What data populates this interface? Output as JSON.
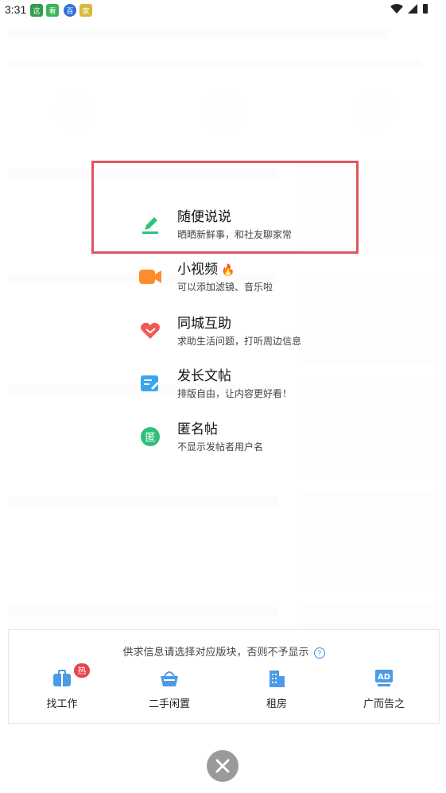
{
  "status_bar": {
    "time": "3:31",
    "apps": [
      "这",
      "看",
      "百",
      "家"
    ]
  },
  "menu": {
    "items": [
      {
        "title": "随便说说",
        "subtitle": "晒晒新鲜事，和社友聊家常",
        "icon": "pencil-icon"
      },
      {
        "title": "小视频",
        "subtitle": "可以添加滤镜、音乐啦",
        "icon": "video-icon",
        "badge": "fire-icon"
      },
      {
        "title": "同城互助",
        "subtitle": "求助生活问题，打听周边信息",
        "icon": "heart-hands-icon"
      },
      {
        "title": "发长文帖",
        "subtitle": "排版自由，让内容更好看！",
        "icon": "document-edit-icon"
      },
      {
        "title": "匿名帖",
        "subtitle": "不显示发帖者用户名",
        "icon": "anonymous-icon"
      }
    ]
  },
  "panel": {
    "note": "供求信息请选择对应版块，否则不予显示",
    "hot_badge": "热",
    "categories": [
      {
        "label": "找工作",
        "icon": "briefcase-icon"
      },
      {
        "label": "二手闲置",
        "icon": "basket-icon"
      },
      {
        "label": "租房",
        "icon": "building-icon"
      },
      {
        "label": "广而告之",
        "icon": "ad-board-icon"
      }
    ]
  },
  "colors": {
    "pencil": "#2fc27a",
    "video": "#fb8d2a",
    "help": "#f05a52",
    "doc": "#3ba4f0",
    "anon": "#2fbf78",
    "accent_blue": "#4c9be8",
    "highlight": "#e05560"
  }
}
